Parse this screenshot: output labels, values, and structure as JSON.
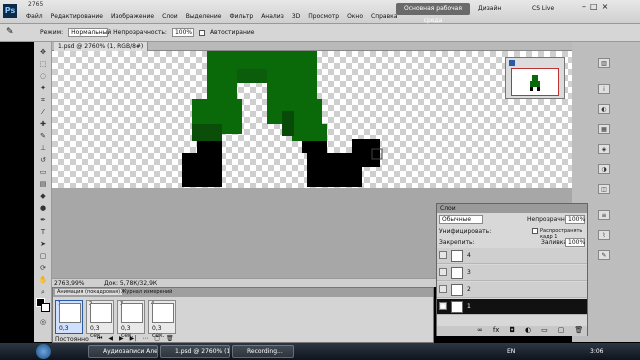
{
  "app": {
    "logo": "Ps",
    "zoom": "2765",
    "workspace": "Основная рабочая среда",
    "design": "Дизайн",
    "cslive": "CS Live"
  },
  "menu": [
    "Файл",
    "Редактирование",
    "Изображение",
    "Слои",
    "Выделение",
    "Фильтр",
    "Анализ",
    "3D",
    "Просмотр",
    "Окно",
    "Справка"
  ],
  "options": {
    "mode_label": "Режим:",
    "mode_value": "Нормальный",
    "opacity_label": "Непрозрачность:",
    "opacity_value": "100%",
    "auto_erase": "Автостирание"
  },
  "document": {
    "tab_title": "1.psd @ 2760% (1, RGB/8#)"
  },
  "status": {
    "zoom": "2763,99%",
    "doc": "Док: 5,78К/32,9К"
  },
  "layers_panel": {
    "title": "Слои",
    "blend_mode": "Обычные",
    "opacity_label": "Непрозрачность:",
    "opacity_value": "100%",
    "unify_label": "Унифицировать:",
    "propagate_label": "Распространять кадр 1",
    "lock_label": "Закрепить:",
    "fill_label": "Заливка:",
    "fill_value": "100%",
    "layers": [
      {
        "name": "4"
      },
      {
        "name": "3"
      },
      {
        "name": "2"
      },
      {
        "name": "1"
      }
    ]
  },
  "animation": {
    "tab1": "Анимация (покадровая)",
    "tab2": "Журнал измерений",
    "loop": "Постоянно",
    "frames": [
      {
        "num": "1",
        "delay": "0,3"
      },
      {
        "num": "2",
        "delay": "0,3 сек."
      },
      {
        "num": "3",
        "delay": "0,3 сек."
      },
      {
        "num": "4",
        "delay": "0,3 сек."
      }
    ]
  },
  "taskbar": {
    "items": [
      "Аудиозаписи Алекс...",
      "1.psd @ 2760% (1...",
      "Recording..."
    ],
    "lang": "EN",
    "time": "3:06"
  }
}
